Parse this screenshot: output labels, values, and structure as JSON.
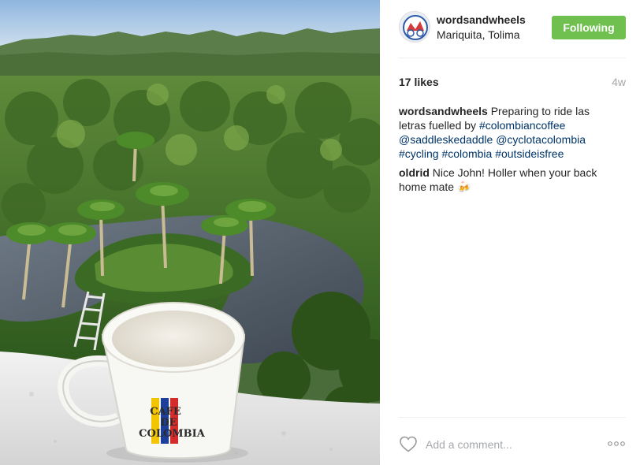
{
  "post": {
    "image_alt": "",
    "author": {
      "username": "wordsandwheels",
      "location": "Mariquita, Tolima",
      "follow_label": "Following"
    },
    "likes": "17 likes",
    "time_ago": "4w",
    "caption": {
      "username": "wordsandwheels",
      "text_1": "Preparing to ride las letras fuelled by",
      "tag_1": "#colombiancoffee",
      "mention_1": "@saddleskedaddle",
      "mention_2": "@cyclotacolombia",
      "tag_2": "#cycling",
      "tag_3": "#colombia",
      "tag_4": "#outsideisfree"
    },
    "comments": [
      {
        "username": "oldrid",
        "text": "Nice John! Holler when your back home mate",
        "emoji": "🍻"
      }
    ],
    "comment_input": {
      "placeholder": "Add a comment..."
    },
    "mug_text": {
      "line1": "CAFE",
      "line2": "DE",
      "line3": "COLOMBIA"
    }
  },
  "icons": {
    "like": "heart-icon",
    "more": "more-options-icon"
  },
  "colors": {
    "follow_button": "#70c050",
    "hashtag": "#003569",
    "muted": "#a5a7aa"
  }
}
